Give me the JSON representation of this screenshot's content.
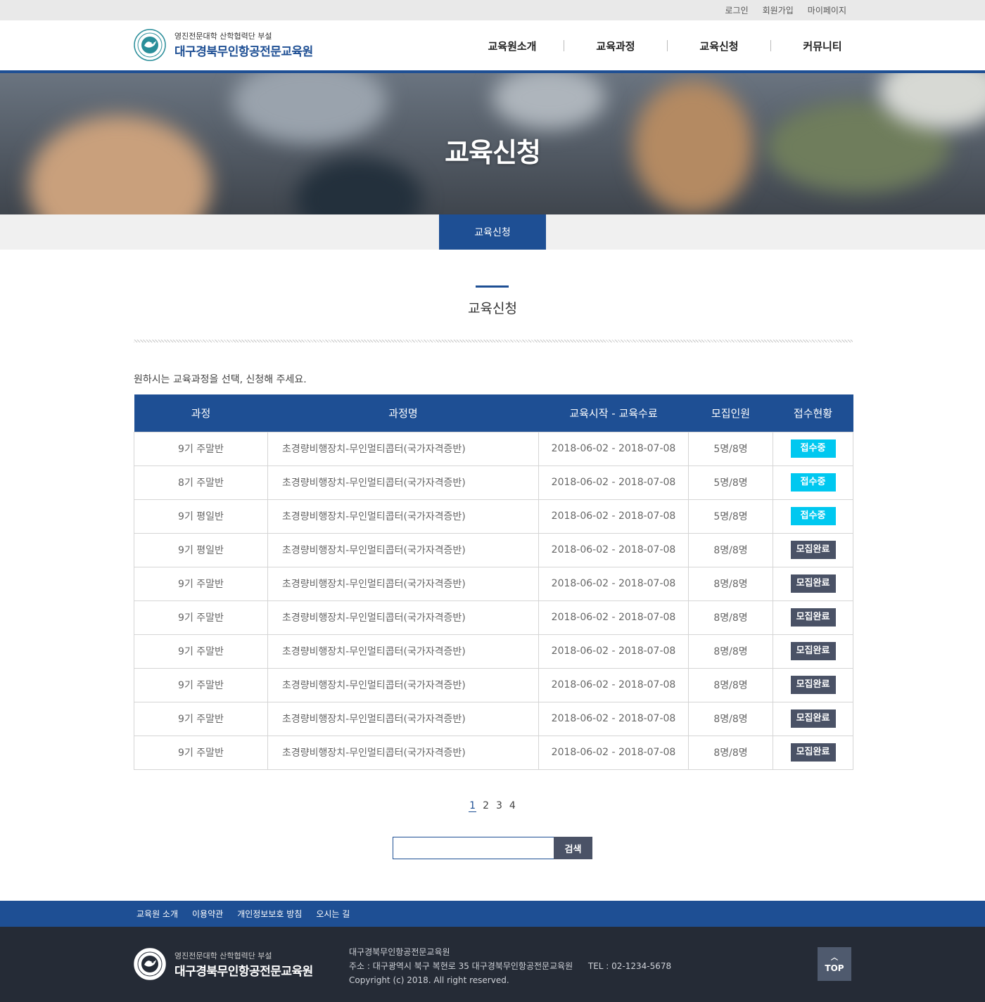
{
  "topbar": {
    "links": [
      "로그인",
      "회원가입",
      "마이페이지"
    ]
  },
  "header": {
    "logo_sub": "영진전문대학 산학협력단 부설",
    "logo_main": "대구경북무인항공전문교육원",
    "nav": [
      "교육원소개",
      "교육과정",
      "교육신청",
      "커뮤니티"
    ]
  },
  "hero": {
    "title": "교육신청"
  },
  "subnav": {
    "active": "교육신청"
  },
  "section": {
    "title": "교육신청",
    "intro": "원하시는 교육과정을 선택, 신청해 주세요."
  },
  "table": {
    "headers": [
      "과정",
      "과정명",
      "교육시작 - 교육수료",
      "모집인원",
      "접수현황"
    ],
    "rows": [
      [
        "9기 주말반",
        "초경량비행장치-무인멀티콥터(국가자격증반)",
        "2018-06-02 - 2018-07-08",
        "5명/8명",
        "접수중"
      ],
      [
        "8기 주말반",
        "초경량비행장치-무인멀티콥터(국가자격증반)",
        "2018-06-02 - 2018-07-08",
        "5명/8명",
        "접수중"
      ],
      [
        "9기 평일반",
        "초경량비행장치-무인멀티콥터(국가자격증반)",
        "2018-06-02 - 2018-07-08",
        "5명/8명",
        "접수중"
      ],
      [
        "9기 평일반",
        "초경량비행장치-무인멀티콥터(국가자격증반)",
        "2018-06-02 - 2018-07-08",
        "8명/8명",
        "모집완료"
      ],
      [
        "9기 주말반",
        "초경량비행장치-무인멀티콥터(국가자격증반)",
        "2018-06-02 - 2018-07-08",
        "8명/8명",
        "모집완료"
      ],
      [
        "9기 주말반",
        "초경량비행장치-무인멀티콥터(국가자격증반)",
        "2018-06-02 - 2018-07-08",
        "8명/8명",
        "모집완료"
      ],
      [
        "9기 주말반",
        "초경량비행장치-무인멀티콥터(국가자격증반)",
        "2018-06-02 - 2018-07-08",
        "8명/8명",
        "모집완료"
      ],
      [
        "9기 주말반",
        "초경량비행장치-무인멀티콥터(국가자격증반)",
        "2018-06-02 - 2018-07-08",
        "8명/8명",
        "모집완료"
      ],
      [
        "9기 주말반",
        "초경량비행장치-무인멀티콥터(국가자격증반)",
        "2018-06-02 - 2018-07-08",
        "8명/8명",
        "모집완료"
      ],
      [
        "9기 주말반",
        "초경량비행장치-무인멀티콥터(국가자격증반)",
        "2018-06-02 - 2018-07-08",
        "8명/8명",
        "모집완료"
      ]
    ]
  },
  "pagination": {
    "pages": [
      "1",
      "2",
      "3",
      "4"
    ],
    "current": "1"
  },
  "search": {
    "value": "",
    "button": "검색"
  },
  "footer": {
    "nav": [
      "교육원 소개",
      "이용약관",
      "개인정보보호 방침",
      "오시는 길"
    ],
    "logo_sub": "영진전문대학 산학협력단 부설",
    "logo_main": "대구경북무인항공전문교육원",
    "info_name": "대구경북무인항공전문교육원",
    "info_address": "주소 : 대구광역시 북구 복현로 35 대구경북무인항공전문교육원",
    "info_tel": "TEL : 02-1234-5678",
    "copyright": "Copyright (c) 2018.  All right reserved.",
    "top_label": "TOP"
  },
  "colors": {
    "brand": "#1e4f94",
    "status_open": "#00c8f0",
    "status_closed": "#4a5266",
    "footer_bg": "#252b36"
  },
  "icons": [
    "emblem-icon",
    "chevron-up-icon"
  ]
}
